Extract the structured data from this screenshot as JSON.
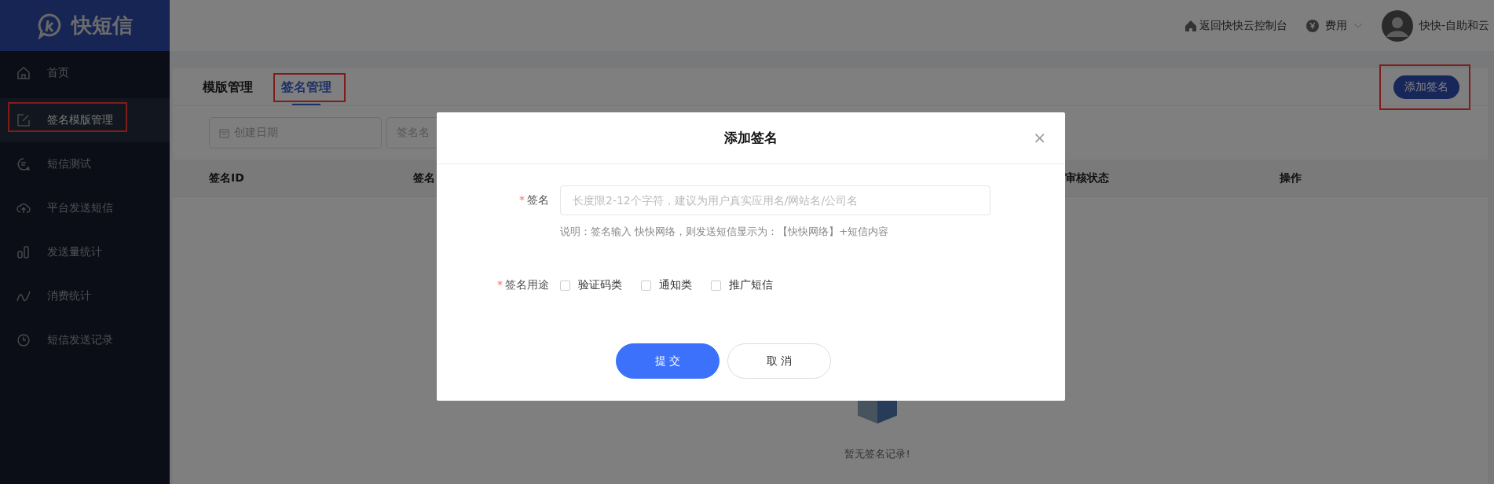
{
  "sidebar": {
    "logo": "快短信",
    "items": [
      {
        "label": "首页",
        "selected": false,
        "highlighted": false
      },
      {
        "label": "签名模版管理",
        "selected": true,
        "highlighted": true
      },
      {
        "label": "短信测试",
        "selected": false,
        "highlighted": false
      },
      {
        "label": "平台发送短信",
        "selected": false,
        "highlighted": false
      },
      {
        "label": "发送量统计",
        "selected": false,
        "highlighted": false
      },
      {
        "label": "消费统计",
        "selected": false,
        "highlighted": false
      },
      {
        "label": "短信发送记录",
        "selected": false,
        "highlighted": false
      }
    ]
  },
  "top_bar": {
    "console_link": "返回快快云控制台",
    "billing_menu": "费用",
    "user_name": "快快-自助和云"
  },
  "tabs": [
    {
      "label": "模版管理",
      "selected": false,
      "highlighted": false
    },
    {
      "label": "签名管理",
      "selected": true,
      "highlighted": true
    }
  ],
  "add_button": {
    "label": "添加签名",
    "highlighted": true
  },
  "filters": {
    "date_placeholder": "创建日期",
    "name_placeholder": "签名名"
  },
  "table": {
    "columns": [
      "签名ID",
      "签名",
      "审核状态",
      "操作"
    ],
    "empty_text": "暂无签名记录!"
  },
  "dialog": {
    "title": "添加签名",
    "close": "×",
    "name_field": {
      "label": "签名",
      "required_mark": "*",
      "placeholder": "长度限2-12个字符，建议为用户真实应用名/网站名/公司名",
      "hint": "说明：签名输入 快快网络，则发送短信显示为：【快快网络】+短信内容"
    },
    "purpose": {
      "label": "签名用途",
      "required_mark": "*",
      "options": [
        {
          "label": "验证码类",
          "checked": false
        },
        {
          "label": "通知类",
          "checked": false
        },
        {
          "label": "推广短信",
          "checked": false
        }
      ]
    },
    "buttons": [
      {
        "label": "提 交",
        "kind": "primary"
      },
      {
        "label": "取 消",
        "kind": "secondary"
      }
    ]
  }
}
